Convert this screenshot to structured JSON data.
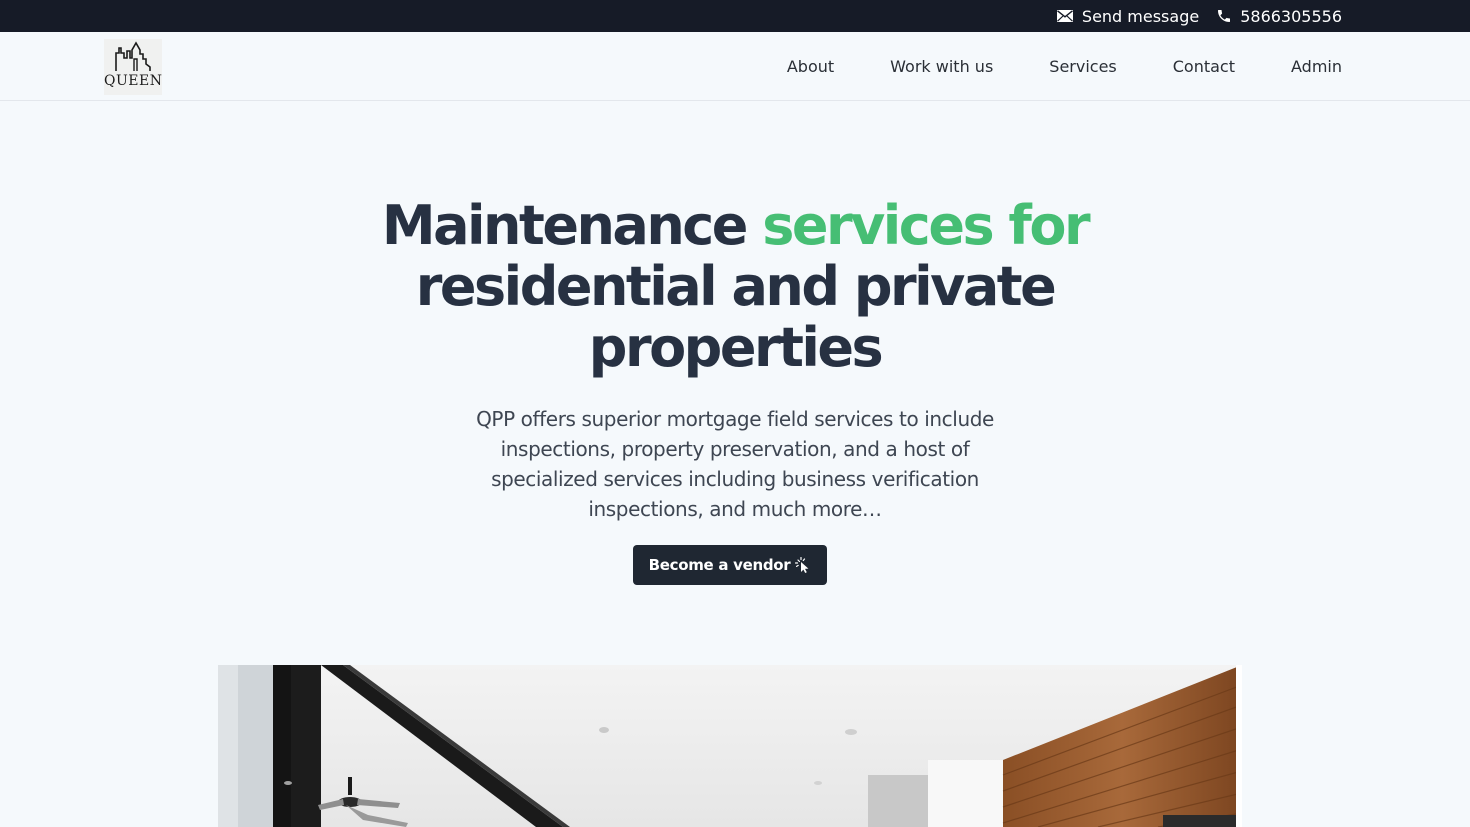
{
  "topbar": {
    "send_message": "Send message",
    "phone": "5866305556",
    "icons": {
      "mail": "mail-icon",
      "phone": "phone-icon"
    }
  },
  "nav": {
    "logo_text": "QUEEN",
    "items": [
      "About",
      "Work with us",
      "Services",
      "Contact",
      "Admin"
    ]
  },
  "hero": {
    "title_part1": "Maintenance ",
    "title_accent": "services for",
    "title_part2": "residential and private properties",
    "description": "QPP offers superior mortgage field services to include inspections, property preservation, and a host of specialized services including business verification inspections, and much more…",
    "cta_label": "Become a vendor",
    "cta_icon": "cursor-click-icon"
  },
  "colors": {
    "topbar_bg": "#161b27",
    "page_bg": "#f5f9fc",
    "heading": "#273142",
    "accent": "#46be74",
    "button_bg": "#1f2732"
  }
}
